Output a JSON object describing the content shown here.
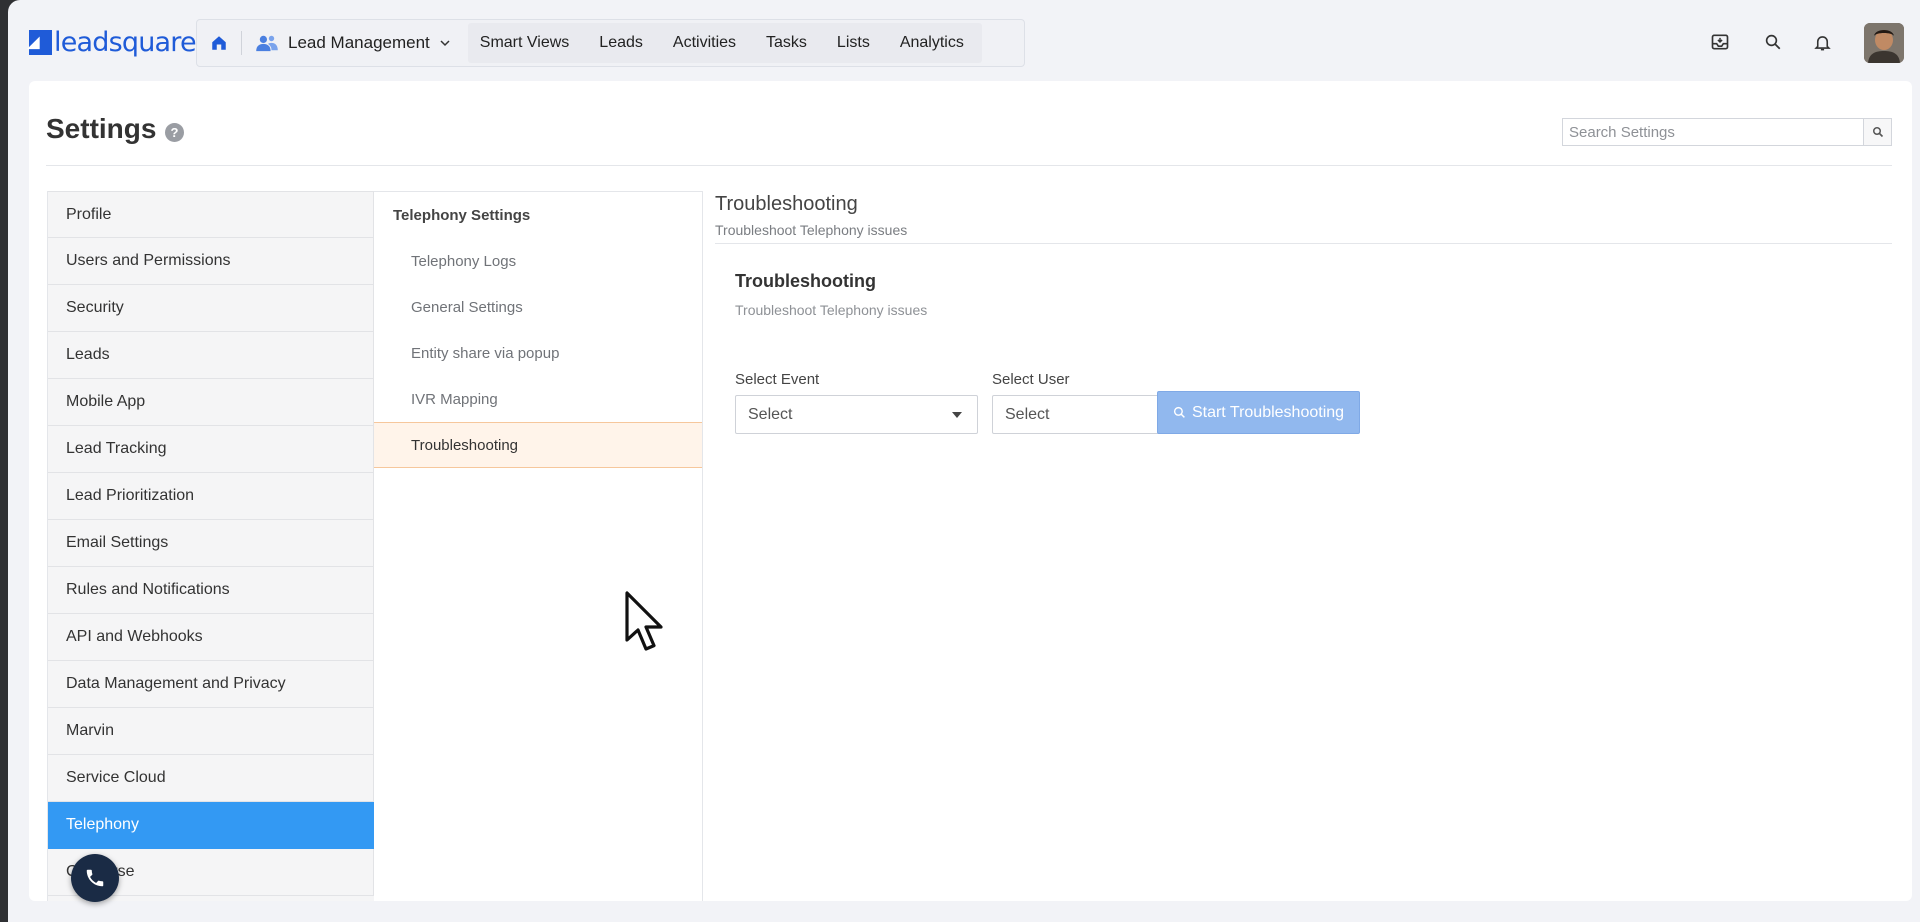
{
  "brand": {
    "logo_text": "leadsquared",
    "accent": "#1f5bd8"
  },
  "nav": {
    "module_label": "Lead Management",
    "links": [
      "Smart Views",
      "Leads",
      "Activities",
      "Tasks",
      "Lists",
      "Analytics"
    ]
  },
  "page": {
    "title": "Settings",
    "search_placeholder": "Search Settings"
  },
  "left_menu": {
    "items": [
      "Profile",
      "Users and Permissions",
      "Security",
      "Leads",
      "Mobile App",
      "Lead Tracking",
      "Lead Prioritization",
      "Email Settings",
      "Rules and Notifications",
      "API and Webhooks",
      "Data Management and Privacy",
      "Marvin",
      "Service Cloud",
      "Telephony",
      "Converse"
    ],
    "active": "Telephony",
    "active_color": "#3399f3"
  },
  "sub_menu": {
    "heading": "Telephony Settings",
    "items": [
      "Telephony Logs",
      "General Settings",
      "Entity share via popup",
      "IVR Mapping",
      "Troubleshooting"
    ],
    "active": "Troubleshooting"
  },
  "content": {
    "title": "Troubleshooting",
    "subtitle": "Troubleshoot Telephony issues",
    "inner_title": "Troubleshooting",
    "inner_subtitle": "Troubleshoot Telephony issues",
    "event_label": "Select Event",
    "event_value": "Select",
    "user_label": "Select User",
    "user_value": "Select",
    "start_button": "Start Troubleshooting"
  }
}
